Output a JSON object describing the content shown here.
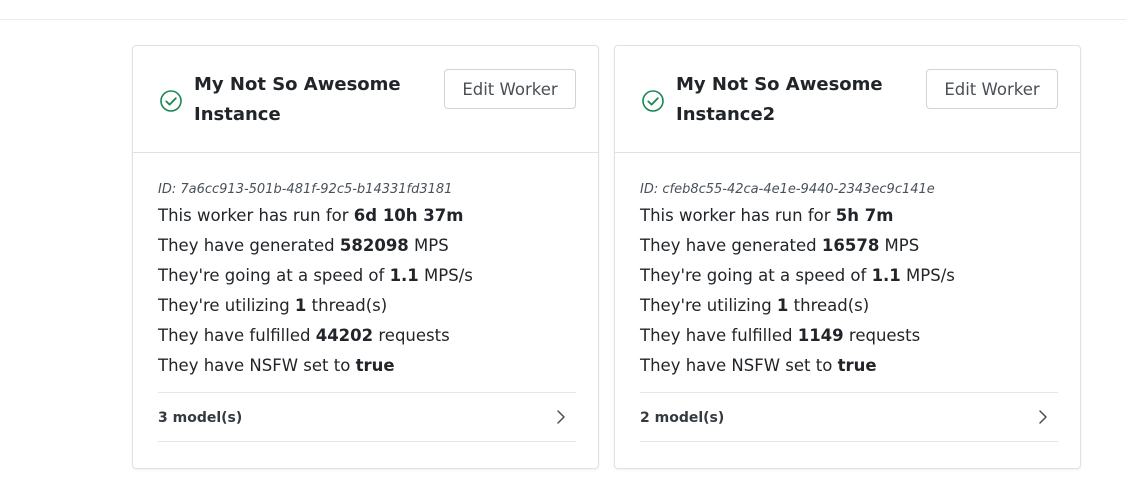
{
  "workers": [
    {
      "title": "My Not So Awesome Instance",
      "edit_label": "Edit Worker",
      "id_text": "ID: 7a6cc913-501b-481f-92c5-b14331fd3181",
      "run_prefix": "This worker has run for ",
      "run_value": "6d 10h 37m",
      "gen_prefix": "They have generated ",
      "gen_value": "582098",
      "gen_suffix": " MPS",
      "speed_prefix": "They're going at a speed of ",
      "speed_value": "1.1",
      "speed_suffix": " MPS/s",
      "threads_prefix": "They're utilizing ",
      "threads_value": "1",
      "threads_suffix": " thread(s)",
      "req_prefix": "They have fulfilled ",
      "req_value": "44202",
      "req_suffix": " requests",
      "nsfw_prefix": "They have NSFW set to ",
      "nsfw_value": "true",
      "models_label": "3 model(s)"
    },
    {
      "title": "My Not So Awesome Instance2",
      "edit_label": "Edit Worker",
      "id_text": "ID: cfeb8c55-42ca-4e1e-9440-2343ec9c141e",
      "run_prefix": "This worker has run for ",
      "run_value": "5h 7m",
      "gen_prefix": "They have generated ",
      "gen_value": "16578",
      "gen_suffix": " MPS",
      "speed_prefix": "They're going at a speed of ",
      "speed_value": "1.1",
      "speed_suffix": " MPS/s",
      "threads_prefix": "They're utilizing ",
      "threads_value": "1",
      "threads_suffix": " thread(s)",
      "req_prefix": "They have fulfilled ",
      "req_value": "1149",
      "req_suffix": " requests",
      "nsfw_prefix": "They have NSFW set to ",
      "nsfw_value": "true",
      "models_label": "2 model(s)"
    }
  ],
  "icons": {
    "status": "check-circle-icon",
    "expand": "chevron-right-icon"
  },
  "colors": {
    "status_ok": "#198754"
  }
}
